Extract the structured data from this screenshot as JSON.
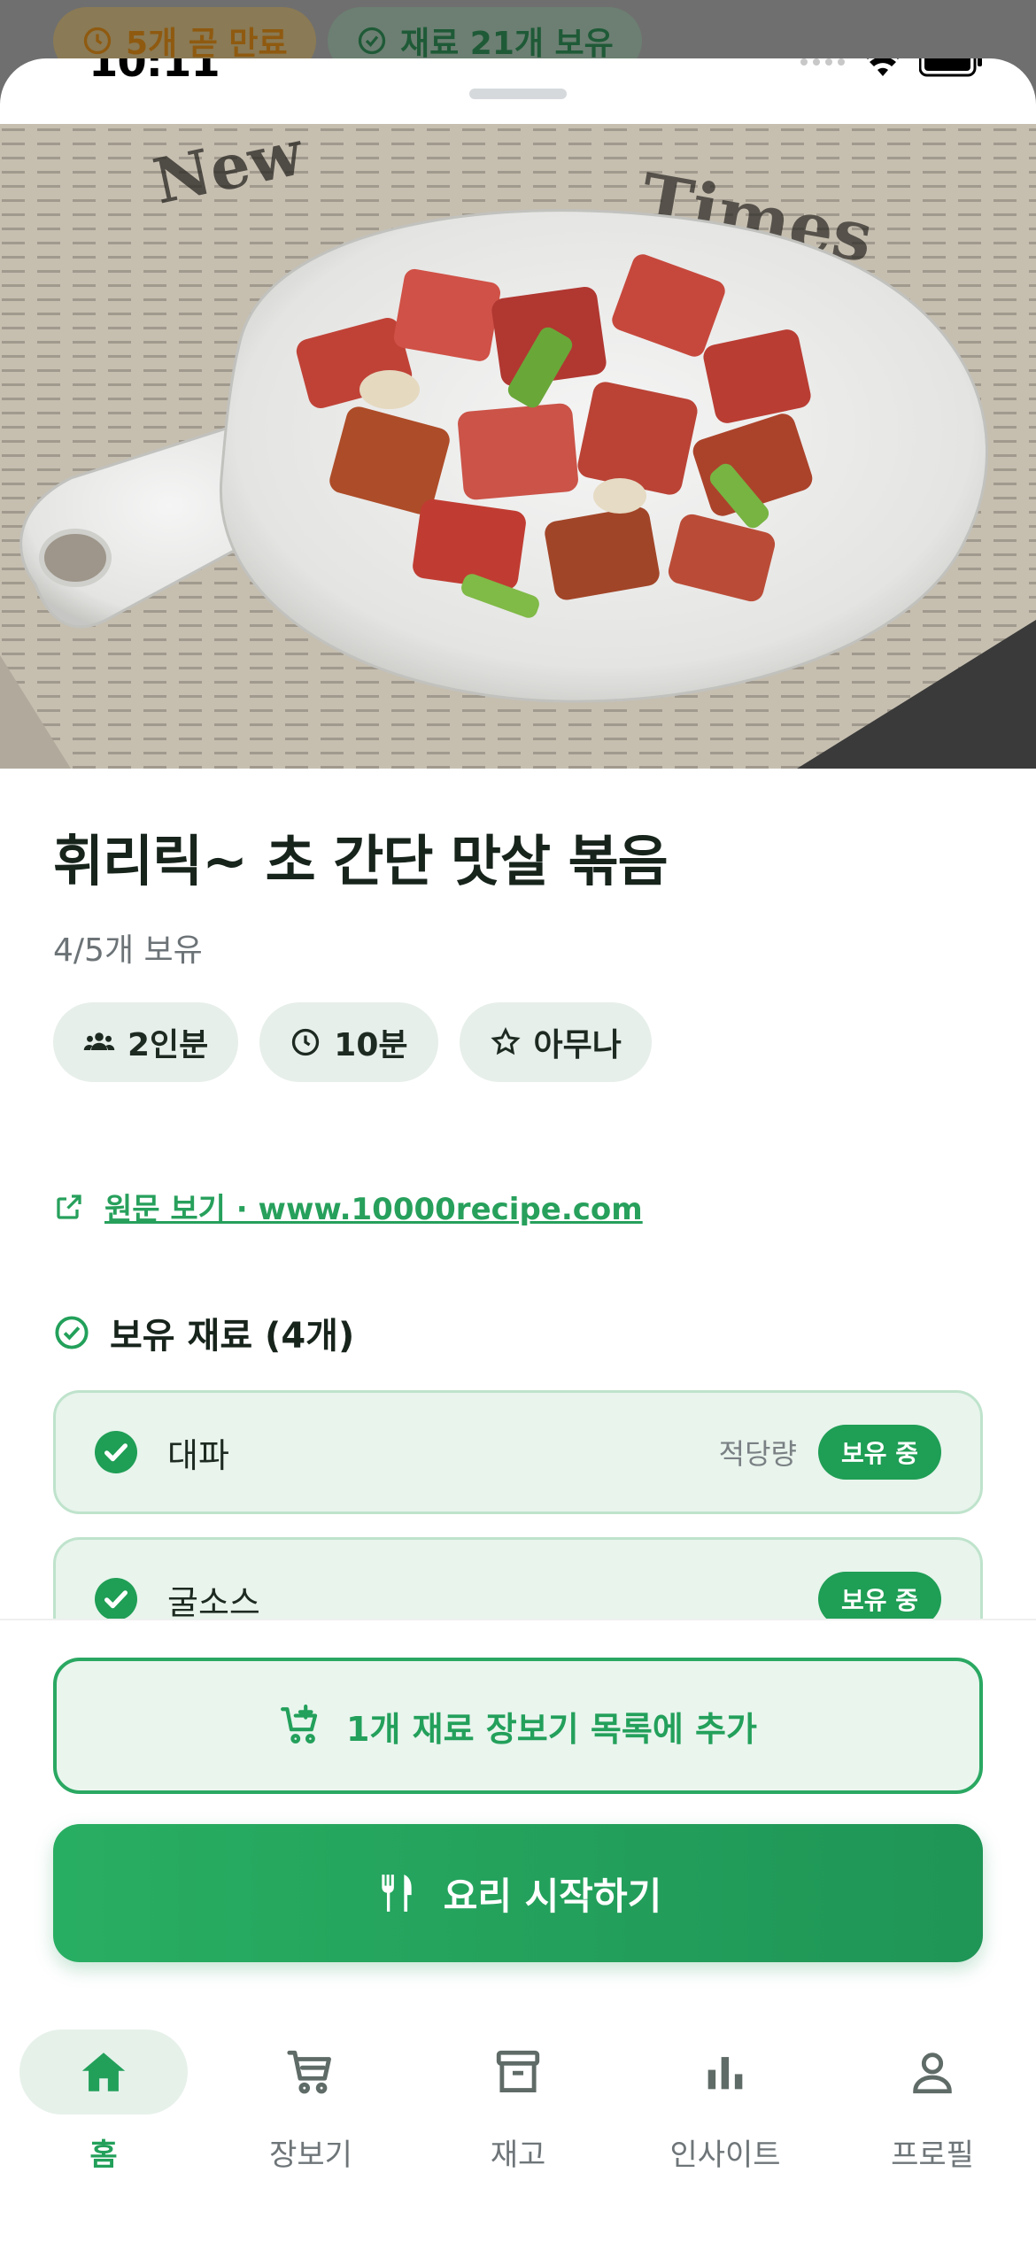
{
  "background_chips": {
    "expiring": "5개 곧 만료",
    "owned": "재료 21개 보유"
  },
  "status_bar": {
    "time": "10:11"
  },
  "recipe": {
    "title": "휘리릭~ 초 간단 맛살 볶음",
    "owned_summary": "4/5개 보유",
    "chips": [
      {
        "icon": "people-icon",
        "label": "2인분"
      },
      {
        "icon": "clock-icon",
        "label": "10분"
      },
      {
        "icon": "star-icon",
        "label": "아무나"
      }
    ],
    "source_link": "원문 보기 · www.10000recipe.com"
  },
  "owned_section": {
    "title": "보유 재료 (4개)",
    "items": [
      {
        "name": "대파",
        "quantity": "적당량",
        "badge": "보유 중"
      },
      {
        "name": "굴소스",
        "quantity": "",
        "badge": "보유 중"
      }
    ]
  },
  "actions": {
    "add_to_shopping": "1개 재료 장보기 목록에 추가",
    "start_cooking": "요리 시작하기"
  },
  "tabbar": {
    "items": [
      {
        "label": "홈",
        "icon": "home-icon",
        "active": true
      },
      {
        "label": "장보기",
        "icon": "cart-icon",
        "active": false
      },
      {
        "label": "재고",
        "icon": "archive-icon",
        "active": false
      },
      {
        "label": "인사이트",
        "icon": "bar-chart-icon",
        "active": false
      },
      {
        "label": "프로필",
        "icon": "person-icon",
        "active": false
      }
    ]
  },
  "colors": {
    "accent": "#22a05a",
    "accent_light": "#e8f4ec",
    "text_dark": "#17241c",
    "muted": "#6c7377"
  }
}
